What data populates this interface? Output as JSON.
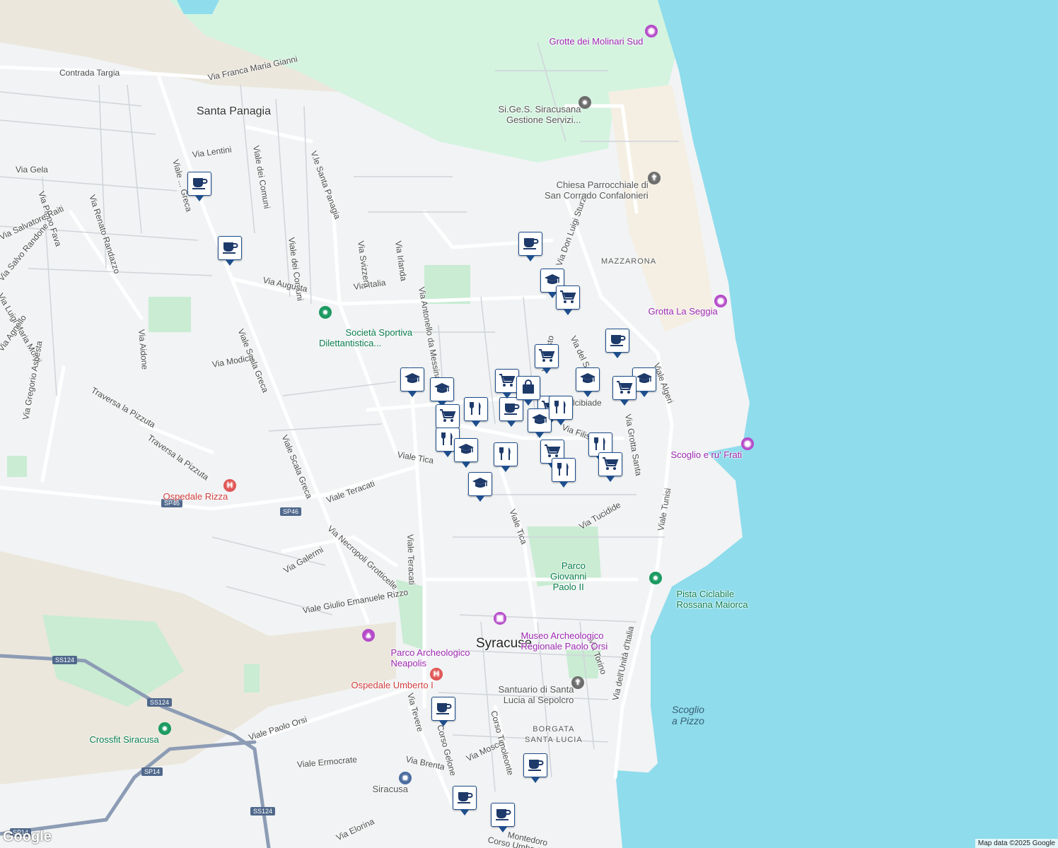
{
  "map": {
    "attribution": "Map data ©2025 Google",
    "logo_text": "Google",
    "colors": {
      "sea": "#8edcec",
      "land": "#f1f3f4",
      "park": "#d2f0dc",
      "beach": "#f4efe2",
      "road": "#ffffff",
      "road_outline": "#c8ccd2",
      "highway": "#8d9cb5",
      "marker_border": "#1e4e8c"
    }
  },
  "labels": {
    "santa_panagia": "Santa Panagia",
    "syracuse": "Syracuse",
    "mazzarona": "MAZZARONA",
    "borgata": "BORGATA\nSANTA LUCIA",
    "scoglio_pizzo": "Scoglio\na Pizzo",
    "contrada_targia": "Contrada Targia",
    "via_franca": "Via Franca Maria Gianni",
    "via_lentini": "Via Lentini",
    "via_gela": "Via Gela",
    "viale_greca": "Viale Scala Greca",
    "viale_greca_top": "Viale ... Greca",
    "via_pippo": "Via Pippo Fava",
    "via_renato": "Via Renato Randazzo",
    "via_salvatore": "Via Salvatore Raiti",
    "via_salvo": "Via Salvo Randone",
    "via_luigi": "Via Luigi Maria Monti",
    "via_agnello": "Via Agnello",
    "via_gregorio": "Via Gregorio Asbesta",
    "via_aidone": "Via Aidone",
    "via_modica": "Via Modica",
    "traversa_pizzuta": "Traversa la Pizzuta",
    "traversa_pizzuta2": "Traversa la Pizzuta",
    "viale_comuni": "Viale dei Comuni",
    "viale_comuni2": "Viale dei Comuni",
    "vle_santa": "V.le Santa Panagia",
    "via_augusta": "Via Augusta",
    "via_italia": "Via Italia",
    "via_svizzera": "Via Svizzera",
    "via_irlanda": "Via Irlanda",
    "via_antonello": "Via Antonello da Messina",
    "via_don_luigi": "Via Don Luigi Sturzo",
    "via_del_se": "Via del Se...",
    "via_filisto": "Via Filisto",
    "via_filisto2": "Via Filis...",
    "via_alcibiade": "...lcibiade",
    "viale_algeri": "Viale Algeri",
    "via_grotta": "Via Grotta Santa",
    "viale_tunisi": "Viale Tunisi",
    "via_tucidide": "Via Tucidide",
    "viale_tica": "Viale Tica",
    "viale_tica2": "Viale Tica",
    "viale_teracati": "Viale Teracati",
    "viale_teracati2": "Viale Teracati",
    "via_necropoli": "Via Necropoli Grotticelle",
    "via_galermi": "Via Galermi",
    "viale_giulio": "Viale Giulio Emanuele Rizzo",
    "viale_paolo": "Viale Paolo Orsi",
    "viale_ermocrate": "Viale Ermocrate",
    "via_brenta": "Via Brenta",
    "via_mosco": "Via Mosco",
    "corso_timoleonte": "Corso Timoleonte",
    "via_tevere": "Via Tevere",
    "corso_gelone": "Corso Gelone",
    "via_torino": "Via Torino",
    "via_unita": "Via dell'Unità d'Italia",
    "via_elorina": "Via Elorina",
    "montedoro": "Montedoro",
    "corso_umberto": "Corso Umbert..."
  },
  "pois": {
    "grotte_molinari": "Grotte dei Molinari Sud",
    "sigess": "Si.Ge.S. Siracusana\nGestione Servizi...",
    "chiesa": "Chiesa Parrocchiale di\nSan Corrado Confalonieri",
    "grotta_seggia": "Grotta La Seggia",
    "societa": "Società Sportiva\nDilettantistica...",
    "scoglio_frati": "Scoglio e ru' Frati",
    "ospedale_rizza": "Ospedale Rizza",
    "parco_giovanni": "Parco\nGiovanni\nPaolo II",
    "pista": "Pista Ciclabile\nRossana Maiorca",
    "museo": "Museo Archeologico\nRegionale Paolo Orsi",
    "parco_neapolis": "Parco Archeologico\nNeapolis",
    "ospedale_umberto": "Ospedale Umberto I",
    "santuario": "Santuario di Santa\nLucia al Sepolcro",
    "crossfit": "Crossfit Siracusa",
    "siracusa_station": "Siracusa"
  },
  "shields": {
    "sp46a": "SP46",
    "sp46b": "SP46",
    "ss124a": "SS124",
    "ss124b": "SS124",
    "ss124c": "SS124",
    "sp14a": "SP14",
    "sp14b": "SP14"
  },
  "markers": [
    {
      "type": "cafe"
    },
    {
      "type": "cafe"
    },
    {
      "type": "cafe"
    },
    {
      "type": "school"
    },
    {
      "type": "shop"
    },
    {
      "type": "cafe"
    },
    {
      "type": "shop"
    },
    {
      "type": "school"
    },
    {
      "type": "school"
    },
    {
      "type": "shop"
    },
    {
      "type": "school"
    },
    {
      "type": "school"
    },
    {
      "type": "shop"
    },
    {
      "type": "restaurant"
    },
    {
      "type": "cafe"
    },
    {
      "type": "shop"
    },
    {
      "type": "school"
    },
    {
      "type": "restaurant"
    },
    {
      "type": "restaurant"
    },
    {
      "type": "school"
    },
    {
      "type": "restaurant"
    },
    {
      "type": "shop"
    },
    {
      "type": "restaurant"
    },
    {
      "type": "restaurant"
    },
    {
      "type": "shop"
    },
    {
      "type": "shop"
    },
    {
      "type": "school"
    },
    {
      "type": "cafe"
    },
    {
      "type": "cafe"
    },
    {
      "type": "cafe"
    },
    {
      "type": "cafe"
    },
    {
      "type": "bag"
    }
  ]
}
